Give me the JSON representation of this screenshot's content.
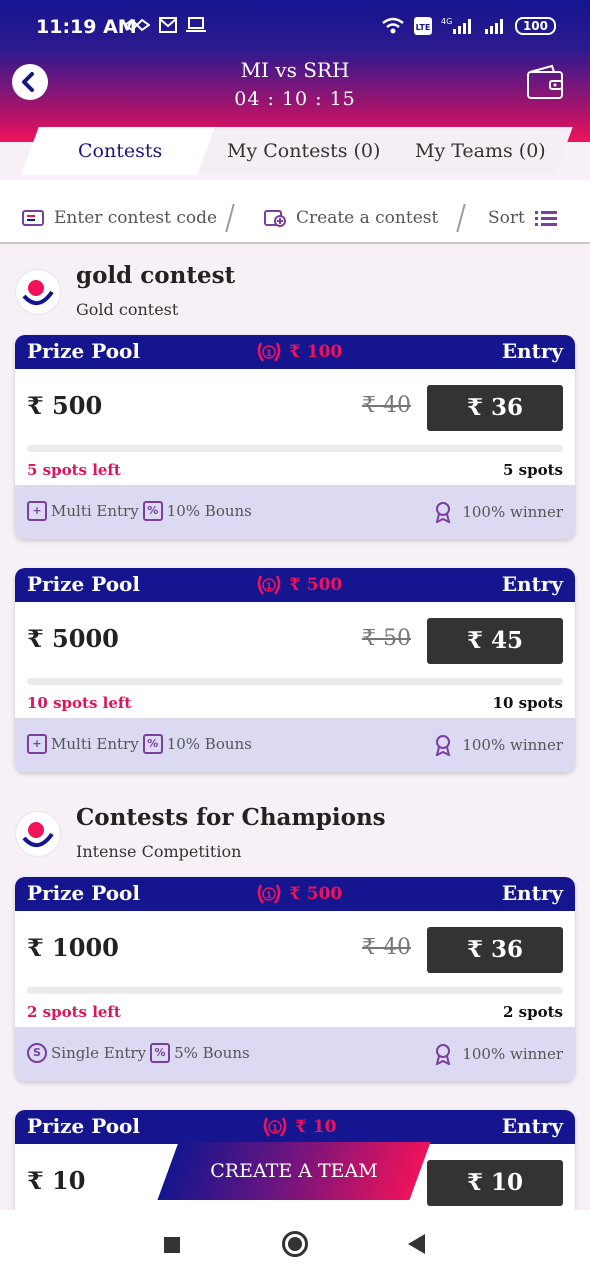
{
  "status": {
    "time": "11:19 AM",
    "network": "4G",
    "battery": "100"
  },
  "header": {
    "title": "MI vs SRH",
    "timer": "04 : 10 : 15"
  },
  "tabs": [
    {
      "label": "Contests"
    },
    {
      "label": "My Contests (0)"
    },
    {
      "label": "My Teams (0)"
    }
  ],
  "actions": {
    "contest_code": "Enter contest code",
    "create_contest": "Create a contest",
    "sort": "Sort"
  },
  "sections": [
    {
      "title": "gold contest",
      "subtitle": "Gold contest"
    },
    {
      "title": "Contests for Champions",
      "subtitle": "Intense Competition"
    }
  ],
  "card_labels": {
    "prize_pool": "Prize Pool",
    "entry": "Entry",
    "winner": "100% winner"
  },
  "cards": [
    {
      "first_prize": "₹ 100",
      "pool": "₹ 500",
      "old_entry": "₹ 40",
      "entry": "₹ 36",
      "spots_left": "5 spots left",
      "spots": "5 spots",
      "filled_fraction": 0,
      "entry_type": "Multi Entry",
      "bonus": "10% Bouns"
    },
    {
      "first_prize": "₹ 500",
      "pool": "₹ 5000",
      "old_entry": "₹ 50",
      "entry": "₹ 45",
      "spots_left": "10 spots left",
      "spots": "10 spots",
      "filled_fraction": 0,
      "entry_type": "Multi Entry",
      "bonus": "10% Bouns"
    },
    {
      "first_prize": "₹ 500",
      "pool": "₹ 1000",
      "old_entry": "₹ 40",
      "entry": "₹ 36",
      "spots_left": "2 spots left",
      "spots": "2 spots",
      "filled_fraction": 0,
      "entry_type": "Single Entry",
      "bonus": "5% Bouns"
    },
    {
      "first_prize": "₹ 10",
      "pool": "₹ 10",
      "entry": "₹ 10"
    }
  ],
  "create_team": "CREATE A TEAM",
  "colors": {
    "primary": "#14158f",
    "accent": "#f0125a",
    "entry_button": "#333333",
    "card_footer": "#dcdaf2"
  }
}
